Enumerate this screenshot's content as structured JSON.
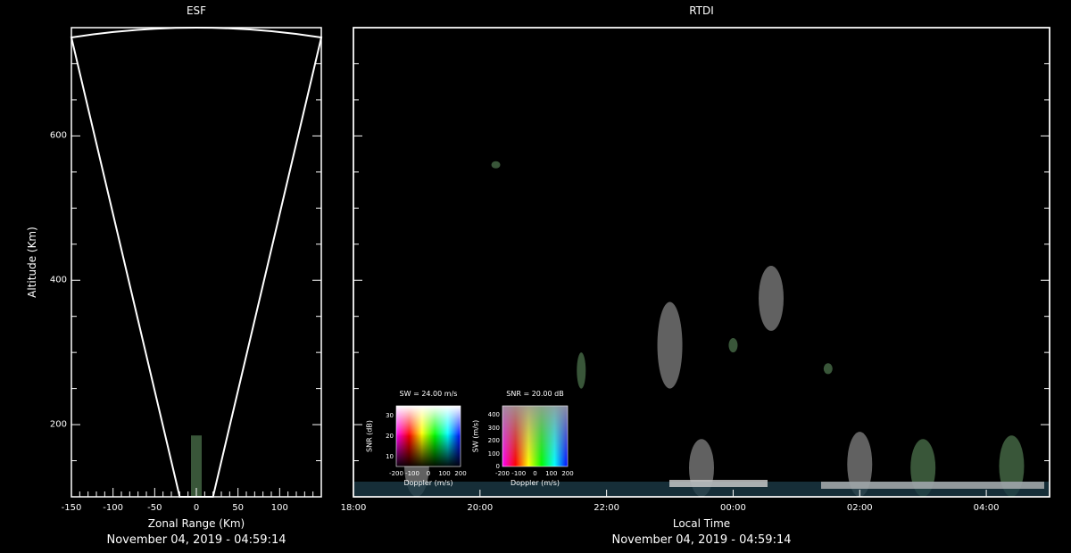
{
  "colors": {
    "background": "#000000",
    "axes": "#ffffff",
    "text": "#ffffff",
    "echo_green": "#7fbf7f",
    "echo_grey": "#d8d8d8",
    "echo_blue": "#4a8aa0"
  },
  "chart_data": [
    {
      "type": "scatter",
      "title": "ESF",
      "xlabel": "Zonal Range (Km)",
      "ylabel": "Altitude (Km)",
      "xlim": [
        -150,
        150
      ],
      "ylim": [
        100,
        750
      ],
      "x_ticks": [
        -150,
        -100,
        -50,
        0,
        50,
        100
      ],
      "y_ticks": [
        200,
        400,
        600
      ],
      "footer": "November 04, 2019 - 04:59:14",
      "beam_cone": {
        "apex_altitude": 100,
        "edges_at_top_km": [
          -150,
          150
        ],
        "apex_spread_km": [
          -20,
          20
        ]
      },
      "echo_patches": [
        {
          "x": 0,
          "y_from": 100,
          "y_to": 185
        }
      ]
    },
    {
      "type": "heatmap",
      "title": "RTDI",
      "xlabel": "Local Time",
      "x_ticks": [
        "18:00",
        "20:00",
        "22:00",
        "00:00",
        "02:00",
        "04:00"
      ],
      "x_range_hours": [
        18,
        29
      ],
      "ylim": [
        100,
        750
      ],
      "y_ticks": [
        200,
        400,
        600
      ],
      "grid": false,
      "footer": "November 04, 2019 - 04:59:14",
      "echo_patches": [
        {
          "t": 20.25,
          "alt_from": 555,
          "alt_to": 565,
          "color": "green"
        },
        {
          "t": 21.6,
          "alt_from": 250,
          "alt_to": 300,
          "color": "green"
        },
        {
          "t": 23.0,
          "alt_from": 250,
          "alt_to": 370,
          "color": "grey"
        },
        {
          "t": 24.0,
          "alt_from": 300,
          "alt_to": 320,
          "color": "green"
        },
        {
          "t": 24.6,
          "alt_from": 330,
          "alt_to": 420,
          "color": "grey"
        },
        {
          "t": 25.5,
          "alt_from": 270,
          "alt_to": 285,
          "color": "green"
        },
        {
          "t": 19.0,
          "alt_from": 100,
          "alt_to": 190,
          "color": "grey"
        },
        {
          "t": 23.5,
          "alt_from": 100,
          "alt_to": 180,
          "color": "grey"
        },
        {
          "t": 26.0,
          "alt_from": 100,
          "alt_to": 190,
          "color": "grey"
        },
        {
          "t": 27.0,
          "alt_from": 100,
          "alt_to": 180,
          "color": "green"
        },
        {
          "t": 28.4,
          "alt_from": 100,
          "alt_to": 185,
          "color": "green"
        }
      ]
    }
  ],
  "legends": [
    {
      "title": "SW = 24.00 m/s",
      "xlabel": "Doppler (m/s)",
      "ylabel": "SNR (dB)",
      "x_ticks": [
        "-200",
        "-100",
        "0",
        "100",
        "200"
      ],
      "y_ticks": [
        "10",
        "20",
        "30"
      ]
    },
    {
      "title": "SNR = 20.00 dB",
      "xlabel": "Doppler (m/s)",
      "ylabel": "SW (m/s)",
      "x_ticks": [
        "-200",
        "-100",
        "0",
        "100",
        "200"
      ],
      "y_ticks": [
        "0",
        "100",
        "200",
        "300",
        "400"
      ]
    }
  ]
}
